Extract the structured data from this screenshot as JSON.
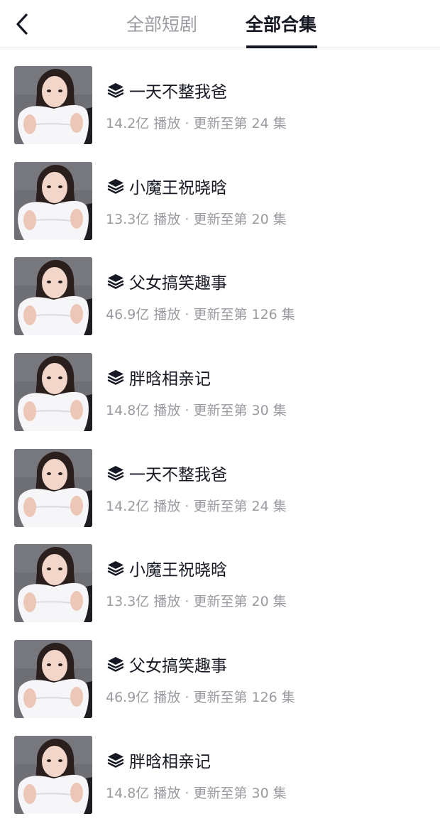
{
  "header": {
    "back_icon": "chevron-left-icon",
    "tabs": [
      {
        "label": "全部短剧",
        "active": false
      },
      {
        "label": "全部合集",
        "active": true
      }
    ]
  },
  "items": [
    {
      "title": "一天不整我爸",
      "meta": "14.2亿 播放 · 更新至第 24 集"
    },
    {
      "title": "小魔王祝晓晗",
      "meta": "13.3亿 播放 · 更新至第 20 集"
    },
    {
      "title": "父女搞笑趣事",
      "meta": "46.9亿 播放 · 更新至第 126 集"
    },
    {
      "title": "胖晗相亲记",
      "meta": "14.8亿 播放 · 更新至第 30 集"
    },
    {
      "title": "一天不整我爸",
      "meta": "14.2亿 播放 · 更新至第 24 集"
    },
    {
      "title": "小魔王祝晓晗",
      "meta": "13.3亿 播放 · 更新至第 20 集"
    },
    {
      "title": "父女搞笑趣事",
      "meta": "46.9亿 播放 · 更新至第 126 集"
    },
    {
      "title": "胖晗相亲记",
      "meta": "14.8亿 播放 · 更新至第 30 集"
    }
  ],
  "item_icon": "stack-layers-icon",
  "thumbnail_icon": "portrait-with-pillow-image"
}
